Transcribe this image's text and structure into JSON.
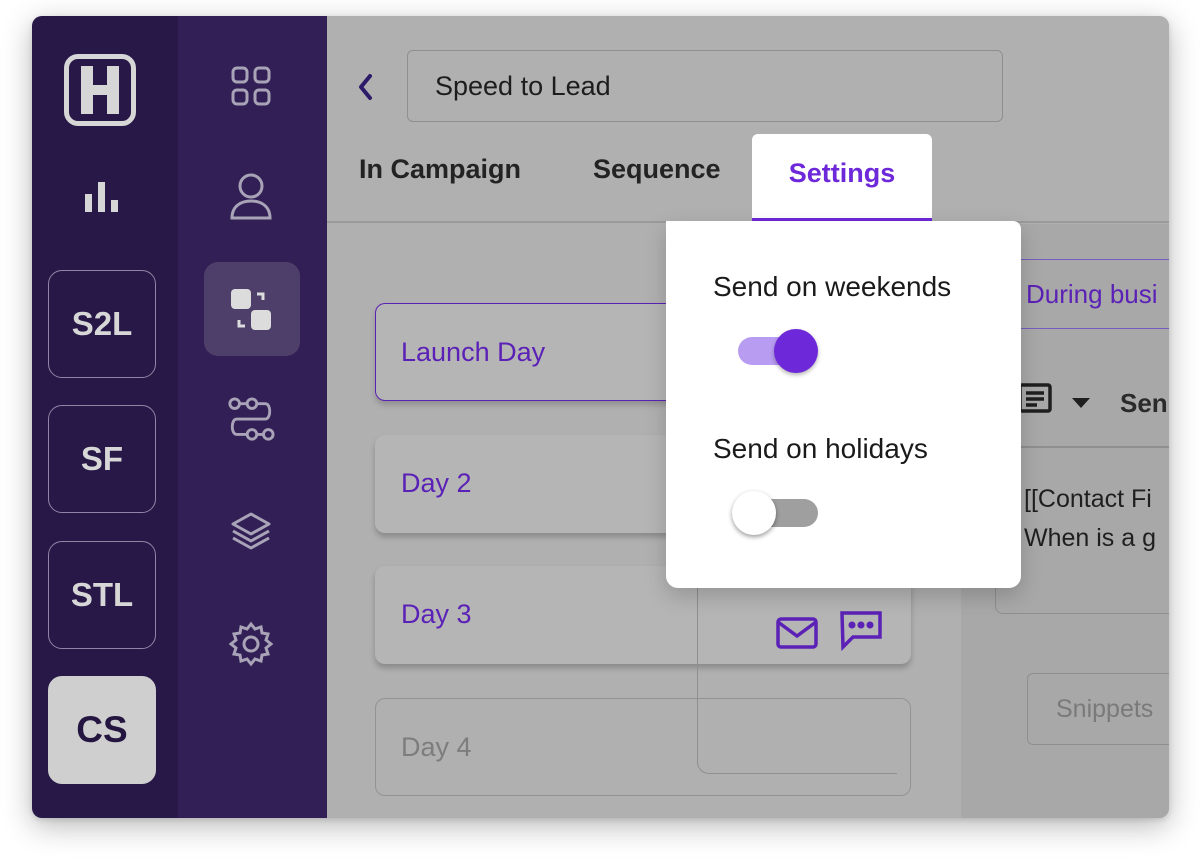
{
  "rail1": {
    "workspaces": [
      {
        "label": "S2L",
        "active": false
      },
      {
        "label": "SF",
        "active": false
      },
      {
        "label": "STL",
        "active": false
      },
      {
        "label": "CS",
        "active": true
      }
    ]
  },
  "rail2": {
    "items": [
      "dashboard-icon",
      "contacts-icon",
      "campaigns-icon",
      "workflows-icon",
      "layers-icon",
      "settings-icon"
    ],
    "active": "campaigns-icon"
  },
  "header": {
    "campaign_name": "Speed to Lead"
  },
  "tabs": {
    "in_campaign": "In Campaign",
    "sequence": "Sequence",
    "settings": "Settings"
  },
  "days": [
    {
      "label": "Launch Day",
      "state": "selected"
    },
    {
      "label": "Day 2",
      "state": "normal"
    },
    {
      "label": "Day 3",
      "state": "normal",
      "icons": [
        "mail-icon",
        "sms-icon"
      ]
    },
    {
      "label": "Day 4",
      "state": "disabled"
    }
  ],
  "right_pane": {
    "timing": "During busi",
    "send_label": "Sen",
    "message_text": "[[Contact Fi\nWhen is a g",
    "snippets": "Snippets"
  },
  "settings_popover": {
    "weekends_label": "Send on weekends",
    "weekends_on": true,
    "holidays_label": "Send on holidays",
    "holidays_on": false
  },
  "colors": {
    "accent": "#6d28d9",
    "rail1_bg": "#281848",
    "rail2_bg": "#311f55"
  }
}
